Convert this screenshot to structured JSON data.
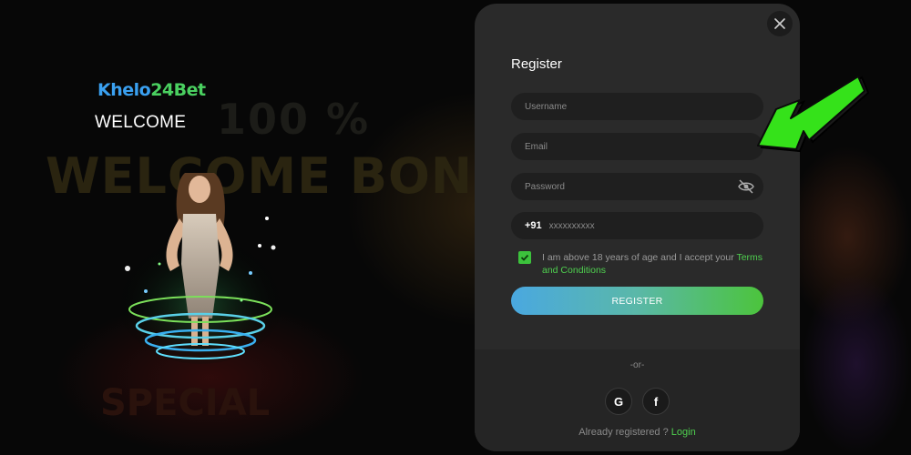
{
  "background": {
    "banner_percent": "100 %",
    "banner_headline": "WELCOME BONU",
    "banner_lower": "SPECIAL"
  },
  "brand": {
    "logo_part1": "Khelo",
    "logo_part2": "24",
    "logo_part3": "Bet",
    "welcome": "WELCOME"
  },
  "modal": {
    "title": "Register",
    "fields": {
      "username_placeholder": "Username",
      "email_placeholder": "Email",
      "password_placeholder": "Password",
      "phone_code": "+91",
      "phone_placeholder": "xxxxxxxxxx"
    },
    "terms_text": "I am above 18 years of age and I accept your ",
    "terms_link": "Terms and Conditions",
    "terms_checked": true,
    "register_label": "REGISTER",
    "or_text": "-or-",
    "social": [
      "google-icon",
      "facebook-icon"
    ],
    "google_glyph": "G",
    "facebook_glyph": "f",
    "already_text": "Already registered ? ",
    "login_link": "Login"
  },
  "colors": {
    "accent_green": "#4fd04f",
    "accent_blue": "#4aa8e0",
    "modal_bg": "#2a2a2a",
    "field_bg": "#1f1f1f"
  }
}
